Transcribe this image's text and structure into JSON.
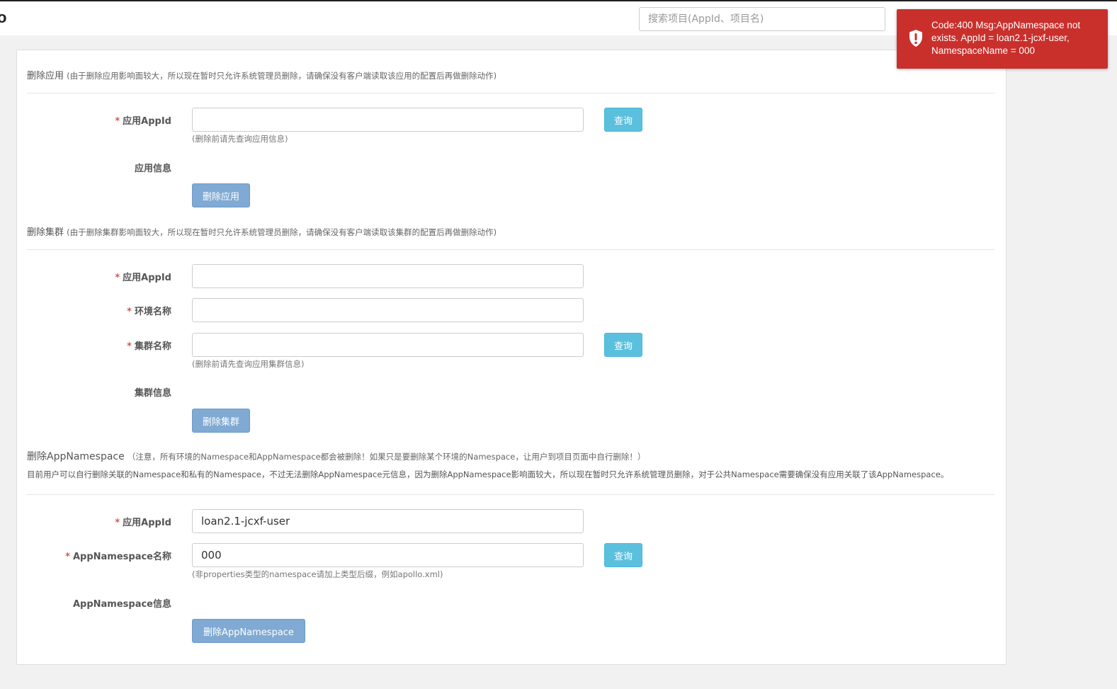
{
  "header": {
    "logo_fragment": "o",
    "search_placeholder": "搜索项目(AppId、项目名)"
  },
  "toast": {
    "icon": "shield-alert-icon",
    "message": "Code:400 Msg:AppNamespace not exists. AppId = loan2.1-jcxf-user, NamespaceName = 000"
  },
  "delete_app": {
    "title": "删除应用",
    "hint": "(由于删除应用影响面较大，所以现在暂时只允许系统管理员删除，请确保没有客户端读取该应用的配置后再做删除动作)",
    "appid_label": "应用AppId",
    "appid_value": "",
    "help": "(删除前请先查询应用信息)",
    "query_button": "查询",
    "info_label": "应用信息",
    "delete_button": "删除应用"
  },
  "delete_cluster": {
    "title": "删除集群",
    "hint": "(由于删除集群影响面较大，所以现在暂时只允许系统管理员删除，请确保没有客户端读取该集群的配置后再做删除动作)",
    "appid_label": "应用AppId",
    "appid_value": "",
    "env_label": "环境名称",
    "env_value": "",
    "cluster_label": "集群名称",
    "cluster_value": "",
    "help": "(删除前请先查询应用集群信息)",
    "query_button": "查询",
    "info_label": "集群信息",
    "delete_button": "删除集群"
  },
  "delete_namespace": {
    "title": "删除AppNamespace",
    "hint": "（注意，所有环境的Namespace和AppNamespace都会被删除！如果只是要删除某个环境的Namespace，让用户到项目页面中自行删除！）",
    "description": "目前用户可以自行删除关联的Namespace和私有的Namespace，不过无法删除AppNamespace元信息，因为删除AppNamespace影响面较大，所以现在暂时只允许系统管理员删除，对于公共Namespace需要确保没有应用关联了该AppNamespace。",
    "appid_label": "应用AppId",
    "appid_value": "loan2.1-jcxf-user",
    "ns_label": "AppNamespace名称",
    "ns_value": "000",
    "help": "(非properties类型的namespace请加上类型后缀，例如apollo.xml)",
    "query_button": "查询",
    "info_label": "AppNamespace信息",
    "delete_button": "删除AppNamespace"
  },
  "colors": {
    "toast_bg": "#c9302c",
    "query_button": "#5bc0de",
    "delete_button": "#80aad3",
    "required_star": "#d9534f"
  }
}
